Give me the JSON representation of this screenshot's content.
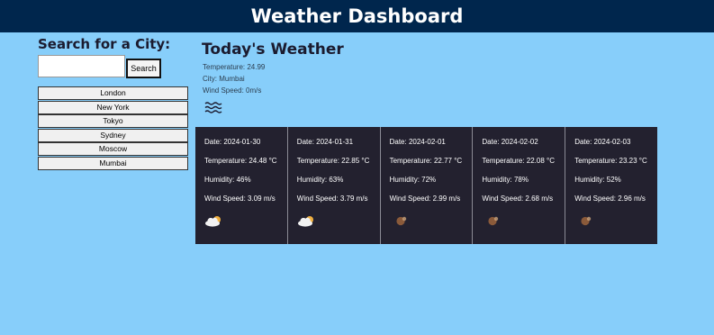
{
  "header": {
    "title": "Weather Dashboard"
  },
  "search": {
    "title": "Search for a City:",
    "input_value": "",
    "input_placeholder": "",
    "button_label": "Search"
  },
  "history": [
    "London",
    "New York",
    "Tokyo",
    "Sydney",
    "Moscow",
    "Mumbai"
  ],
  "today": {
    "title": "Today's Weather",
    "temperature": "Temperature: 24.99",
    "city": "City: Mumbai",
    "wind": "Wind Speed: 0m/s",
    "icon": "mist-icon"
  },
  "forecast": [
    {
      "date": "Date: 2024-01-30",
      "temperature": "Temperature: 24.48 °C",
      "humidity": "Humidity: 46%",
      "wind": "Wind Speed: 3.09 m/s",
      "icon": "partly-cloudy-icon"
    },
    {
      "date": "Date: 2024-01-31",
      "temperature": "Temperature: 22.85 °C",
      "humidity": "Humidity: 63%",
      "wind": "Wind Speed: 3.79 m/s",
      "icon": "partly-cloudy-icon"
    },
    {
      "date": "Date: 2024-02-01",
      "temperature": "Temperature: 22.77 °C",
      "humidity": "Humidity: 72%",
      "wind": "Wind Speed: 2.99 m/s",
      "icon": "haze-icon"
    },
    {
      "date": "Date: 2024-02-02",
      "temperature": "Temperature: 22.08 °C",
      "humidity": "Humidity: 78%",
      "wind": "Wind Speed: 2.68 m/s",
      "icon": "haze-icon"
    },
    {
      "date": "Date: 2024-02-03",
      "temperature": "Temperature: 23.23 °C",
      "humidity": "Humidity: 52%",
      "wind": "Wind Speed: 2.96 m/s",
      "icon": "haze-icon"
    }
  ],
  "colors": {
    "page_background": "#87cefa",
    "header_background": "#00264d",
    "forecast_background": "#23212f"
  }
}
